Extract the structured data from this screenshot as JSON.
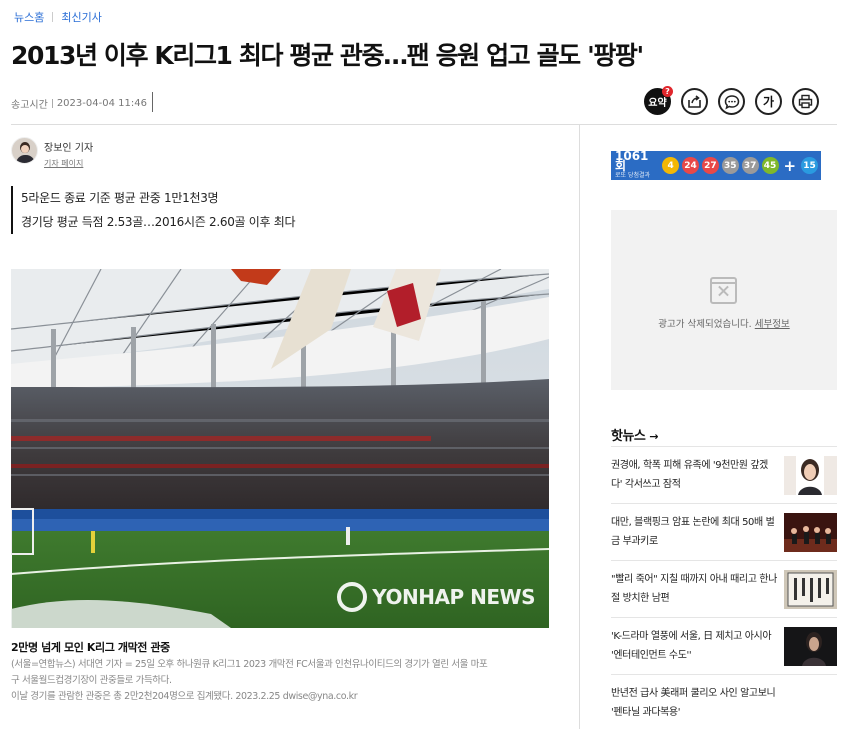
{
  "breadcrumb": {
    "home": "뉴스홈",
    "section": "최신기사"
  },
  "headline": "2013년 이후 K리그1 최다 평균 관중…팬 응원 업고 골도 '팡팡'",
  "meta": {
    "label": "송고시간",
    "datetime": "2023-04-04 11:46"
  },
  "tools": {
    "summary_label": "요약",
    "summary_badge": "?",
    "font_label": "가"
  },
  "byline": {
    "name": "장보인 기자",
    "page_link": "기자 페이지"
  },
  "subheads": [
    "5라운드 종료 기준 평균 관중 1만1천3명",
    "경기당 평균 득점 2.53골…2016시즌 2.60골 이후 최다"
  ],
  "photo": {
    "watermark": "YONHAP NEWS"
  },
  "caption": {
    "title": "2만명 넘게 모인 K리그 개막전 관중",
    "lines": [
      "(서울=연합뉴스) 서대연 기자 = 25일 오후 하나원큐 K리그1 2023 개막전 FC서울과 인천유나이티드의 경기가 열린 서울 마포",
      "구 서울월드컵경기장이 관중들로 가득하다.",
      "이날 경기를 관람한 관중은 총 2만2천204명으로 집계됐다. 2023.2.25 dwise@yna.co.kr"
    ]
  },
  "lotto": {
    "round": "1061회",
    "sub": "로또 당첨결과",
    "numbers": [
      "4",
      "24",
      "27",
      "35",
      "37",
      "45"
    ],
    "bonus": "15",
    "colors": [
      "#f2b705",
      "#e84848",
      "#e84848",
      "#9a9a9a",
      "#9a9a9a",
      "#7fb82b",
      "#2a9be0"
    ]
  },
  "ad": {
    "message": "광고가 삭제되었습니다.",
    "details": "세부정보"
  },
  "hot_news": {
    "title": "핫뉴스",
    "items": [
      "권경애, 학폭 피해 유족에 '9천만원 갚겠다' 각서쓰고 잠적",
      "대만, 블랙핑크 암표 논란에 최대 50배 벌금 부과키로",
      "\"빨리 죽어\" 지칠 때까지 아내 때리고 한나절 방치한 남편",
      "'K-드라마 열풍에 서울, 日 제치고 아시아 '엔터테인먼트 수도''",
      "반년전 급사 美래퍼 쿨리오 사인 알고보니 '펜타닐 과다복용'"
    ]
  }
}
